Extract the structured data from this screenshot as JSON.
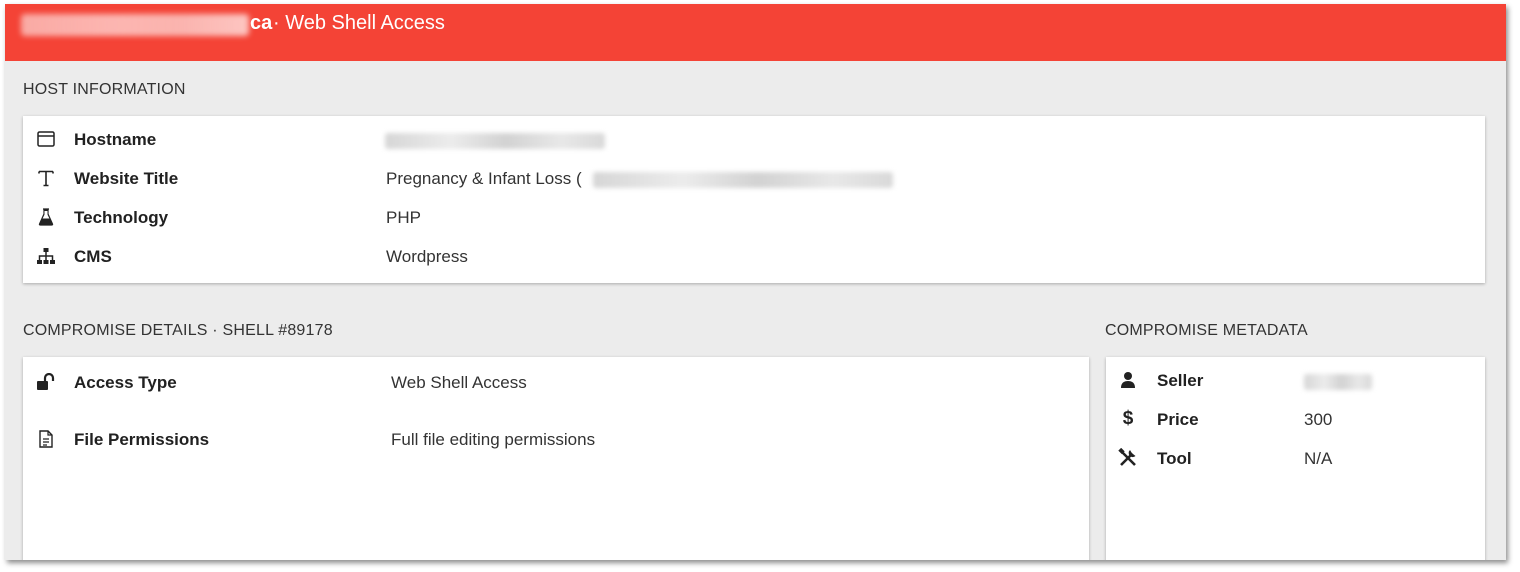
{
  "window": {
    "title_tld": "ca",
    "title_suffix": "· Web Shell Access"
  },
  "host_information": {
    "heading": "HOST INFORMATION",
    "rows": [
      {
        "icon": "browser-window-icon",
        "label": "Hostname",
        "value": ""
      },
      {
        "icon": "text-type-icon",
        "label": "Website Title",
        "value": "Pregnancy & Infant Loss ("
      },
      {
        "icon": "flask-icon",
        "label": "Technology",
        "value": "PHP"
      },
      {
        "icon": "sitemap-icon",
        "label": "CMS",
        "value": "Wordpress"
      }
    ]
  },
  "compromise_details": {
    "heading": "COMPROMISE DETAILS · SHELL #89178",
    "rows": [
      {
        "icon": "unlock-icon",
        "label": "Access Type",
        "value": "Web Shell Access"
      },
      {
        "icon": "file-document-icon",
        "label": "File Permissions",
        "value": "Full file editing permissions"
      }
    ]
  },
  "compromise_metadata": {
    "heading": "COMPROMISE METADATA",
    "rows": [
      {
        "icon": "user-icon",
        "label": "Seller",
        "value": ""
      },
      {
        "icon": "dollar-icon",
        "label": "Price",
        "value": "300"
      },
      {
        "icon": "tools-icon",
        "label": "Tool",
        "value": "N/A"
      }
    ]
  },
  "colors": {
    "titlebar": "#f44336",
    "background": "#ececec",
    "card": "#ffffff"
  }
}
